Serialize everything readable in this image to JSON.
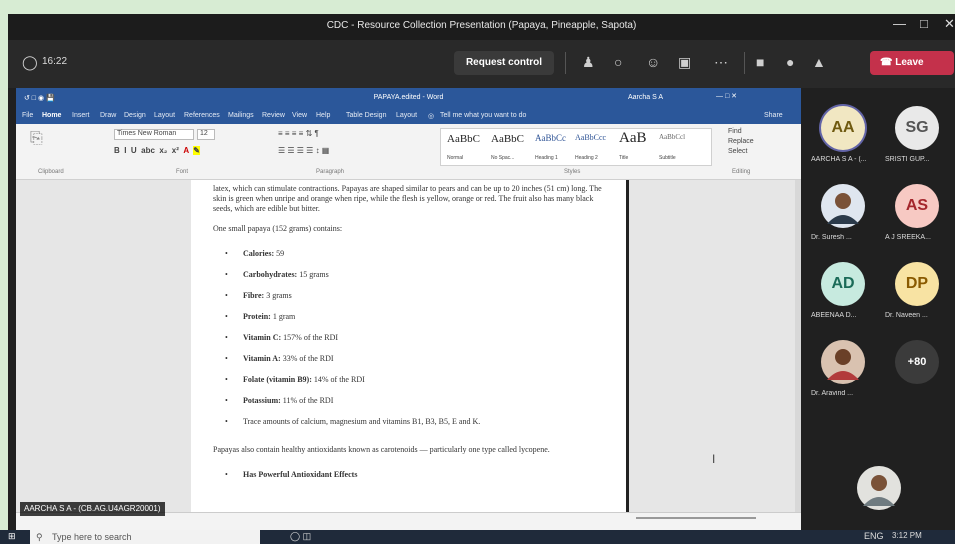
{
  "window": {
    "title": "CDC - Resource Collection Presentation (Papaya, Pineapple, Sapota)"
  },
  "meeting": {
    "time": "16:22",
    "request_control": "Request control",
    "leave": "Leave",
    "presenter": "AARCHA S A - (CB.AG.U4AGR20001)"
  },
  "word": {
    "doc_title": "PAPAYA.edited - Word",
    "user": "Aarcha S A",
    "tabs": [
      "File",
      "Home",
      "Insert",
      "Draw",
      "Design",
      "Layout",
      "References",
      "Mailings",
      "Review",
      "View",
      "Help",
      "Table Design",
      "Layout"
    ],
    "tell_me": "Tell me what you want to do",
    "share": "Share",
    "font": "Times New Roman",
    "font_size": "12",
    "styles": [
      "AaBbC",
      "AaBbC",
      "AaBbCc",
      "AaBbCcc",
      "AaB",
      "AaBbCcl"
    ],
    "style_names": [
      "Normal",
      "No Spac...",
      "Heading 1",
      "Heading 2",
      "Title",
      "Subtitle"
    ],
    "editing": [
      "Find",
      "Replace",
      "Select"
    ],
    "groups": [
      "Clipboard",
      "Font",
      "Paragraph",
      "Styles",
      "Editing"
    ]
  },
  "document": {
    "intro": "latex, which can stimulate contractions. Papayas are shaped similar to pears and can be up to 20 inches (51 cm) long. The skin is green when unripe and orange when ripe, while the flesh is yellow, orange or red. The fruit also has many black seeds, which are edible but bitter.",
    "contains": "One small papaya (152 grams) contains:",
    "nutrients": [
      {
        "label": "Calories:",
        "value": " 59"
      },
      {
        "label": "Carbohydrates:",
        "value": " 15 grams"
      },
      {
        "label": "Fibre:",
        "value": " 3 grams"
      },
      {
        "label": "Protein:",
        "value": " 1 gram"
      },
      {
        "label": "Vitamin C:",
        "value": " 157% of the RDI"
      },
      {
        "label": "Vitamin A:",
        "value": " 33% of the RDI"
      },
      {
        "label": "Folate (vitamin B9):",
        "value": " 14% of the RDI"
      },
      {
        "label": "Potassium:",
        "value": " 11% of the RDI"
      },
      {
        "label": "",
        "value": "Trace amounts of calcium, magnesium and vitamins B1, B3, B5, E and K."
      }
    ],
    "antioxidants": "Papayas also contain healthy antioxidants known as carotenoids — particularly one type called lycopene.",
    "heading": "Has Powerful Antioxidant Effects"
  },
  "participants": [
    {
      "initials": "AA",
      "name": "AARCHA S A - (...",
      "bg": "#f1e7c2",
      "ring": "#6264a7",
      "color": "#6f5a10"
    },
    {
      "initials": "SG",
      "name": "SRISTI GUP...",
      "bg": "#e9e9e9",
      "ring": "",
      "color": "#555555"
    },
    {
      "initials": "",
      "name": "Dr. Suresh ...",
      "bg": "#3a3a3a",
      "ring": "",
      "color": "#ffffff"
    },
    {
      "initials": "AS",
      "name": "A J SREEKA...",
      "bg": "#f7c9c3",
      "ring": "",
      "color": "#a4262c"
    },
    {
      "initials": "AD",
      "name": "ABEENAA D...",
      "bg": "#c7eadf",
      "ring": "",
      "color": "#1b6b58"
    },
    {
      "initials": "DP",
      "name": "Dr. Naveen ...",
      "bg": "#f8e3a3",
      "ring": "",
      "color": "#8a5a00"
    },
    {
      "initials": "",
      "name": "Dr. Aravind ...",
      "bg": "#3a3a3a",
      "ring": "",
      "color": "#ffffff"
    },
    {
      "initials": "+80",
      "name": "",
      "bg": "#3b3b3b",
      "ring": "",
      "color": "#ffffff"
    }
  ],
  "taskbar": {
    "search": "Type here to search",
    "lang": "ENG",
    "time": "3:12 PM"
  }
}
